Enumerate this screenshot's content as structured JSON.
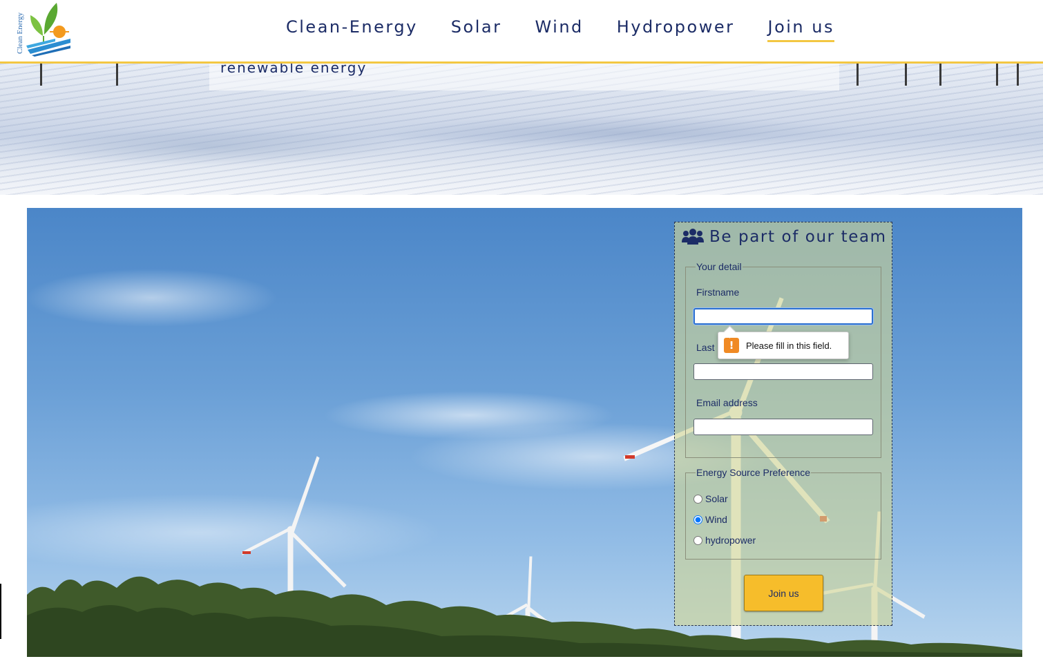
{
  "header": {
    "logo_text": "Clean Energy",
    "nav": [
      {
        "label": "Clean-Energy"
      },
      {
        "label": "Solar"
      },
      {
        "label": "Wind"
      },
      {
        "label": "Hydropower"
      },
      {
        "label": "Join us",
        "active": true
      }
    ],
    "accent_color": "#f3c742"
  },
  "banner": {
    "caption": "renewable energy"
  },
  "form": {
    "title": "Be part of our team",
    "title_icon": "users-icon",
    "detail_legend": "Your detail",
    "firstname_label": "Firstname",
    "firstname_value": "",
    "lastname_label": "Last",
    "lastname_value": "",
    "email_label": "Email address",
    "email_value": "",
    "energy_legend": "Energy Source Preference",
    "energy_options": [
      {
        "label": "Solar",
        "checked": false
      },
      {
        "label": "Wind",
        "checked": true
      },
      {
        "label": "hydropower",
        "checked": false
      }
    ],
    "submit_label": "Join us",
    "button_color": "#f6bd2b"
  },
  "validation": {
    "icon": "warning-icon",
    "message": "Please fill in this field."
  }
}
